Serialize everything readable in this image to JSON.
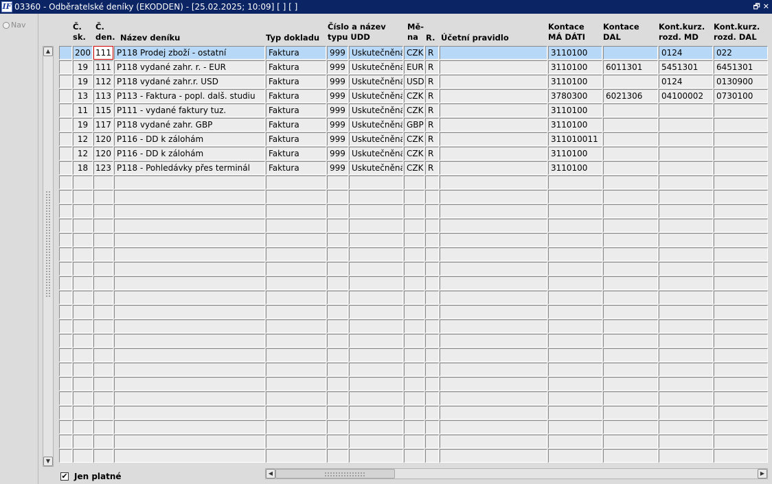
{
  "window": {
    "title": "03360 - Odběratelské deníky (EKODDEN) - [25.02.2025; 10:09]  [ ]  [ ]",
    "icon_label": "IF",
    "restore_glyph": "🗗",
    "close_glyph": "✕"
  },
  "nav": {
    "label": "Nav"
  },
  "headers": {
    "sk": "Č.\nsk.",
    "den": "Č.\nden.",
    "nazev": "Název deníku",
    "typ": "Typ dokladu",
    "udd": "Číslo a název\ntypu UDD",
    "mena": "Mě-\nna",
    "r": "R.",
    "pravidlo": "Účetní pravidlo",
    "ma_dati": "Kontace\nMÁ DÁTI",
    "dal": "Kontace\nDAL",
    "kurz_md": "Kont.kurz.\nrozd. MD",
    "kurz_dal": "Kont.kurz.\nrozd. DAL"
  },
  "rows": [
    {
      "sk": "200",
      "den": "111",
      "nazev": "P118 Prodej zboží - ostatní",
      "typ": "Faktura",
      "udd_cislo": "999",
      "udd_nazev": "Uskutečněná",
      "mena": "CZK",
      "r": "R",
      "pravidlo": "",
      "ma_dati": "3110100",
      "dal": "",
      "kurz_md": "0124",
      "kurz_dal": "022"
    },
    {
      "sk": "19",
      "den": "111",
      "nazev": "P118 vydané zahr. r. - EUR",
      "typ": "Faktura",
      "udd_cislo": "999",
      "udd_nazev": "Uskutečněná",
      "mena": "EUR",
      "r": "R",
      "pravidlo": "",
      "ma_dati": "3110100",
      "dal": "6011301",
      "kurz_md": "5451301",
      "kurz_dal": "6451301"
    },
    {
      "sk": "19",
      "den": "112",
      "nazev": "P118 vydané zahr.r. USD",
      "typ": "Faktura",
      "udd_cislo": "999",
      "udd_nazev": "Uskutečněná",
      "mena": "USD",
      "r": "R",
      "pravidlo": "",
      "ma_dati": "3110100",
      "dal": "",
      "kurz_md": "0124",
      "kurz_dal": "0130900"
    },
    {
      "sk": "13",
      "den": "113",
      "nazev": "P113 - Faktura - popl. dalš. studiu",
      "typ": "Faktura",
      "udd_cislo": "999",
      "udd_nazev": "Uskutečněná",
      "mena": "CZK",
      "r": "R",
      "pravidlo": "",
      "ma_dati": "3780300",
      "dal": "6021306",
      "kurz_md": "04100002",
      "kurz_dal": "0730100"
    },
    {
      "sk": "11",
      "den": "115",
      "nazev": "P111 - vydané faktury tuz.",
      "typ": "Faktura",
      "udd_cislo": "999",
      "udd_nazev": "Uskutečněná",
      "mena": "CZK",
      "r": "R",
      "pravidlo": "",
      "ma_dati": "3110100",
      "dal": "",
      "kurz_md": "",
      "kurz_dal": ""
    },
    {
      "sk": "19",
      "den": "117",
      "nazev": "P118 vydané zahr. GBP",
      "typ": "Faktura",
      "udd_cislo": "999",
      "udd_nazev": "Uskutečněná",
      "mena": "GBP",
      "r": "R",
      "pravidlo": "",
      "ma_dati": "3110100",
      "dal": "",
      "kurz_md": "",
      "kurz_dal": ""
    },
    {
      "sk": "12",
      "den": "120",
      "nazev": "P116 - DD k zálohám",
      "typ": "Faktura",
      "udd_cislo": "999",
      "udd_nazev": "Uskutečněná",
      "mena": "CZK",
      "r": "R",
      "pravidlo": "",
      "ma_dati": "311010011",
      "dal": "",
      "kurz_md": "",
      "kurz_dal": ""
    },
    {
      "sk": "12",
      "den": "120",
      "nazev": "P116 - DD k zálohám",
      "typ": "Faktura",
      "udd_cislo": "999",
      "udd_nazev": "Uskutečněná",
      "mena": "CZK",
      "r": "R",
      "pravidlo": "",
      "ma_dati": "3110100",
      "dal": "",
      "kurz_md": "",
      "kurz_dal": ""
    },
    {
      "sk": "18",
      "den": "123",
      "nazev": "P118 - Pohledávky přes terminál",
      "typ": "Faktura",
      "udd_cislo": "999",
      "udd_nazev": "Uskutečněná",
      "mena": "CZK",
      "r": "R",
      "pravidlo": "",
      "ma_dati": "3110100",
      "dal": "",
      "kurz_md": "",
      "kurz_dal": ""
    }
  ],
  "empty_rows": 20,
  "filter": {
    "label": "Jen platné",
    "checked": true,
    "check_glyph": "✔"
  },
  "colors": {
    "titlebar": "#0a2464",
    "selected_row": "#b7d8f6",
    "focus_border": "#d40000"
  }
}
